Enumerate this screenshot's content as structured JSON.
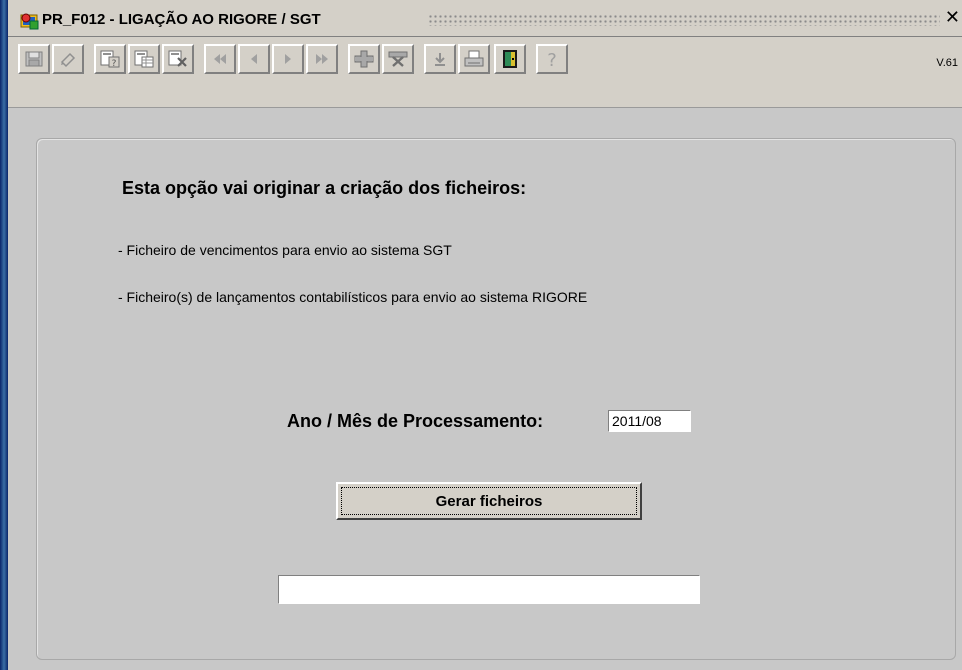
{
  "window": {
    "title": "PR_F012 - LIGAÇÃO AO RIGORE / SGT",
    "close_glyph": "✕"
  },
  "toolbar": {
    "version": "V.61",
    "buttons": [
      {
        "name": "save-icon"
      },
      {
        "name": "undo-icon"
      },
      {
        "name": "query-icon"
      },
      {
        "name": "execute-query-icon"
      },
      {
        "name": "cancel-query-icon"
      },
      {
        "name": "first-record-icon"
      },
      {
        "name": "previous-record-icon"
      },
      {
        "name": "next-record-icon"
      },
      {
        "name": "last-record-icon"
      },
      {
        "name": "insert-record-icon"
      },
      {
        "name": "delete-record-icon"
      },
      {
        "name": "download-icon"
      },
      {
        "name": "print-icon"
      },
      {
        "name": "exit-door-icon"
      },
      {
        "name": "help-icon"
      }
    ]
  },
  "main": {
    "heading": "Esta opção vai originar a criação dos ficheiros:",
    "lines": [
      "- Ficheiro de vencimentos para envio ao sistema SGT",
      "- Ficheiro(s) de lançamentos contabilísticos para envio ao sistema RIGORE"
    ],
    "processing_label": "Ano / Mês de Processamento:",
    "processing_value": "2011/08",
    "generate_button": "Gerar ficheiros",
    "status_value": ""
  }
}
